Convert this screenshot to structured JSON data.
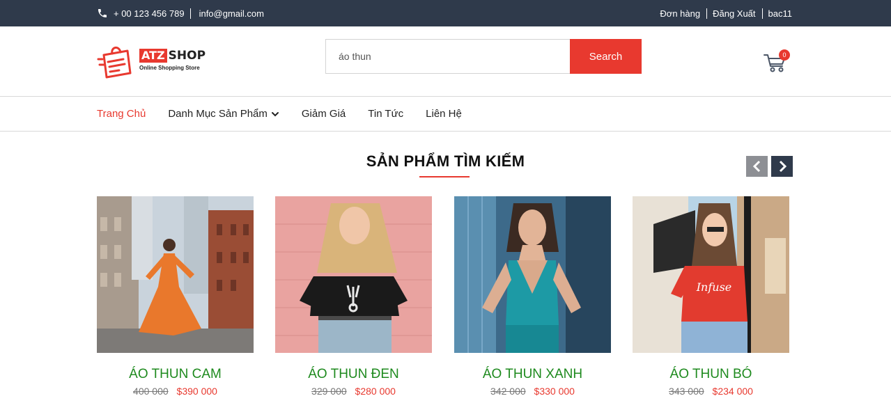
{
  "topbar": {
    "phone": "+ 00 123 456 789",
    "email": "info@gmail.com",
    "links": [
      "Đơn hàng",
      "Đăng Xuất",
      "bac11"
    ]
  },
  "logo": {
    "brand_left": "ATZ",
    "brand_right": "SHOP",
    "tagline": "Online Shopping Store"
  },
  "search": {
    "value": "áo thun",
    "button": "Search"
  },
  "cart": {
    "count": "0"
  },
  "nav": {
    "items": [
      "Trang Chủ",
      "Danh Mục Sản Phẩm",
      "Giảm Giá",
      "Tin Tức",
      "Liên Hệ"
    ]
  },
  "section": {
    "title": "SẢN PHẨM TÌM KIẾM"
  },
  "products": [
    {
      "name": "ÁO THUN CAM",
      "old_price": "400 000",
      "price": "$390 000"
    },
    {
      "name": "ÁO THUN ĐEN",
      "old_price": "329 000",
      "price": "$280 000"
    },
    {
      "name": "ÁO THUN XANH",
      "old_price": "342 000",
      "price": "$330 000"
    },
    {
      "name": "ÁO THUN BÓ",
      "old_price": "343 000",
      "price": "$234 000"
    }
  ],
  "colors": {
    "topbar_bg": "#2f3a4b",
    "accent": "#e8392f",
    "product_name": "#1e8a1e"
  }
}
